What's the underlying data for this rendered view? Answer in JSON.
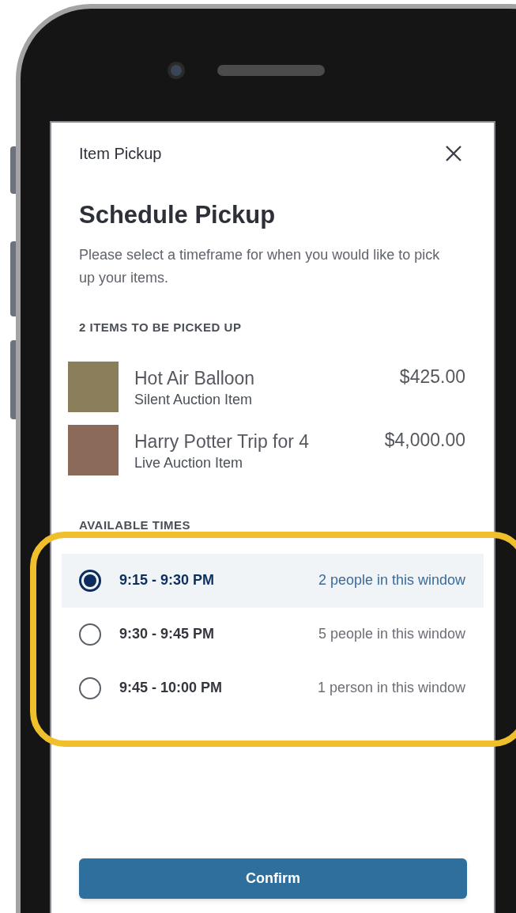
{
  "header": {
    "title": "Item Pickup"
  },
  "heading": "Schedule Pickup",
  "description": "Please select a timeframe for when you would like to pick up your items.",
  "items_label": "2 ITEMS TO BE PICKED UP",
  "items": [
    {
      "name": "Hot Air Balloon",
      "type": "Silent Auction Item",
      "price": "$425.00"
    },
    {
      "name": "Harry Potter Trip for 4",
      "type": "Live Auction Item",
      "price": "$4,000.00"
    }
  ],
  "times_label": "AVAILABLE TIMES",
  "times": [
    {
      "time": "9:15 - 9:30 PM",
      "count": "2 people in this window",
      "selected": true
    },
    {
      "time": "9:30 - 9:45 PM",
      "count": "5 people in this window",
      "selected": false
    },
    {
      "time": "9:45 - 10:00 PM",
      "count": "1 person in this window",
      "selected": false
    }
  ],
  "confirm": "Confirm"
}
